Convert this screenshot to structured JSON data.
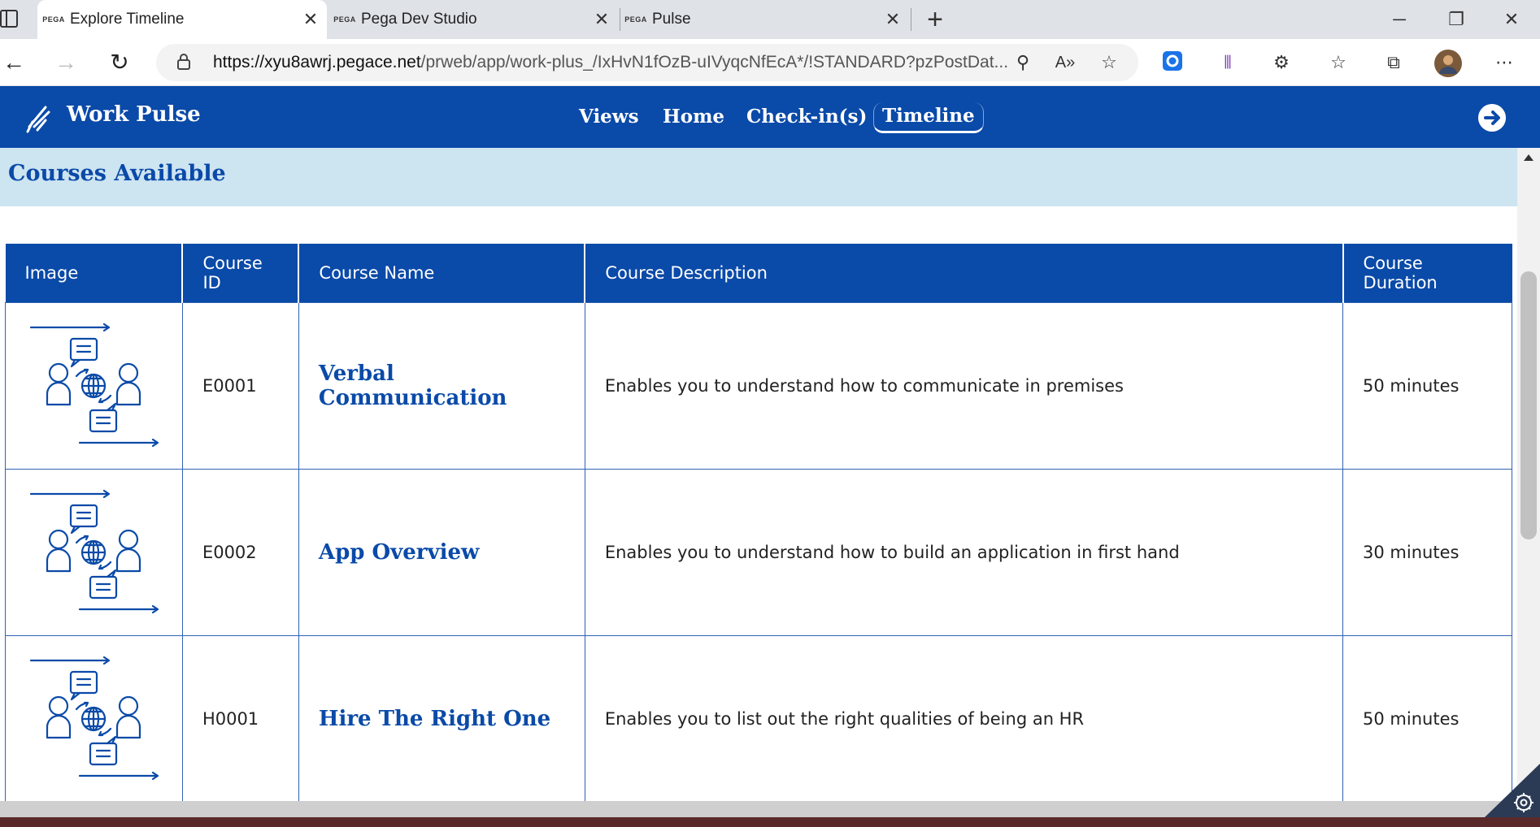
{
  "browser": {
    "tabs": [
      {
        "favicon": "PEGA",
        "title": "Explore Timeline",
        "active": true
      },
      {
        "favicon": "PEGA",
        "title": "Pega Dev Studio",
        "active": false
      },
      {
        "favicon": "PEGA",
        "title": "Pulse",
        "active": false
      }
    ],
    "url_host": "https://xyu8awrj.pegace.net",
    "url_path": "/prweb/app/work-plus_/IxHvN1fOzB-uIVyqcNfEcA*/!STANDARD?pzPostDat..."
  },
  "app": {
    "brand": "Work Pulse",
    "nav": [
      {
        "label": "Views"
      },
      {
        "label": "Home"
      },
      {
        "label": "Check-in(s)"
      },
      {
        "label": "Timeline",
        "active": true
      }
    ],
    "accent_color": "#0a4aa8"
  },
  "section": {
    "title": "Courses Available"
  },
  "table": {
    "headers": [
      "Image",
      "Course ID",
      "Course Name",
      "Course Description",
      "Course Duration"
    ],
    "rows": [
      {
        "id": "E0001",
        "name": "Verbal Communication",
        "description": "Enables you to understand how to communicate in premises",
        "duration": "50 minutes"
      },
      {
        "id": "E0002",
        "name": "App Overview",
        "description": "Enables you to understand how to build an application in first hand",
        "duration": "30 minutes"
      },
      {
        "id": "H0001",
        "name": "Hire The Right One",
        "description": "Enables you to list out the right qualities of being an HR",
        "duration": "50 minutes"
      }
    ]
  }
}
